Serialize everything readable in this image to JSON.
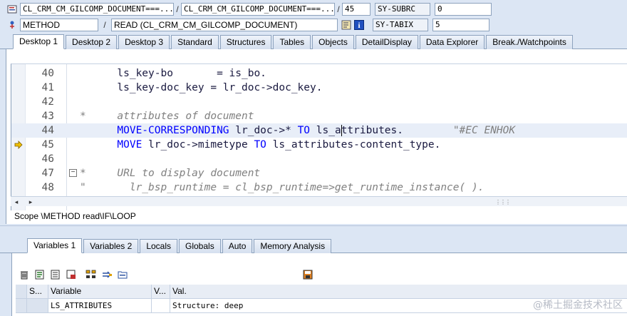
{
  "header": {
    "row1": {
      "program": "CL_CRM_CM_GILCOMP_DOCUMENT===...",
      "include": "CL_CRM_CM_GILCOMP_DOCUMENT===...",
      "line": "45",
      "sysfield_name": "SY-SUBRC",
      "sysfield_value": "0"
    },
    "row2": {
      "event_type": "METHOD",
      "event_name": "READ (CL_CRM_CM_GILCOMP_DOCUMENT)",
      "sysfield_name": "SY-TABIX",
      "sysfield_value": "5"
    }
  },
  "desktop_tabs": [
    "Desktop 1",
    "Desktop 2",
    "Desktop 3",
    "Standard",
    "Structures",
    "Tables",
    "Objects",
    "DetailDisplay",
    "Data Explorer",
    "Break./Watchpoints"
  ],
  "active_desktop_tab": "Desktop 1",
  "code": {
    "lines": [
      {
        "num": "40",
        "indent": "      ",
        "parts": [
          [
            "plain",
            "ls_key-bo       = is_bo."
          ]
        ]
      },
      {
        "num": "41",
        "indent": "      ",
        "parts": [
          [
            "plain",
            "ls_key-doc_key = lr_doc->doc_key."
          ]
        ]
      },
      {
        "num": "42",
        "indent": "",
        "parts": []
      },
      {
        "num": "43",
        "indent": "",
        "parts": [
          [
            "cm",
            "*     attributes of document"
          ]
        ]
      },
      {
        "num": "44",
        "indent": "      ",
        "parts": [
          [
            "kw",
            "MOVE-CORRESPONDING"
          ],
          [
            "plain",
            " lr_doc->* "
          ],
          [
            "kw",
            "TO"
          ],
          [
            "plain",
            " ls_a"
          ],
          [
            "cursor",
            ""
          ],
          [
            "plain",
            "ttributes.        "
          ],
          [
            "cm",
            "\"#EC ENHOK"
          ]
        ]
      },
      {
        "num": "45",
        "indent": "      ",
        "parts": [
          [
            "kw",
            "MOVE"
          ],
          [
            "plain",
            " lr_doc->mimetype "
          ],
          [
            "kw",
            "TO"
          ],
          [
            "plain",
            " ls_attributes-content_type."
          ]
        ]
      },
      {
        "num": "46",
        "indent": "",
        "parts": []
      },
      {
        "num": "47",
        "indent": "",
        "parts": [
          [
            "cm",
            "*     URL to display document"
          ]
        ]
      },
      {
        "num": "48",
        "indent": "",
        "parts": [
          [
            "cm",
            "\"       lr_bsp_runtime = cl_bsp_runtime=>get_runtime_instance( )."
          ]
        ]
      }
    ]
  },
  "scope": "Scope \\METHOD read\\IF\\LOOP",
  "variable_tabs": [
    "Variables 1",
    "Variables 2",
    "Locals",
    "Globals",
    "Auto",
    "Memory Analysis"
  ],
  "active_variable_tab": "Variables 1",
  "grid": {
    "headers": [
      "S...",
      "Variable",
      "V...",
      "Val."
    ],
    "rows": [
      {
        "variable": "LS_ATTRIBUTES",
        "value": "Structure: deep"
      }
    ]
  },
  "watermark": "@稀土掘金技术社区",
  "colors": {
    "keyword": "#0000ff",
    "comment": "#808080",
    "exec_arrow": "#f0c000"
  }
}
